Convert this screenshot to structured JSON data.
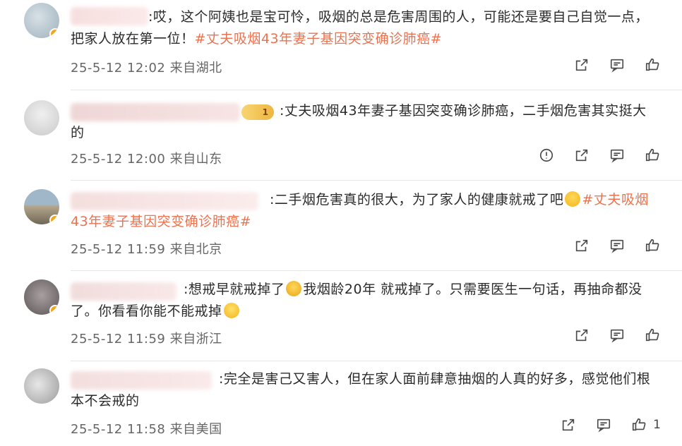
{
  "colors": {
    "hashtag": "#eb7350",
    "text": "#2b2b2b",
    "meta": "#666666",
    "divider": "#e6e6e6"
  },
  "comments": [
    {
      "text": ":哎，这个阿姨也是宝可怜，吸烟的总是危害周围的人，可能还是要自己自觉一点，把家人放在第一位！",
      "hashtag": "#丈夫吸烟43年妻子基因突变确诊肺癌#",
      "time": "25-5-12 12:02",
      "location": "来自湖北"
    },
    {
      "badge": "1",
      "text": ":丈夫吸烟43年妻子基因突变确诊肺癌，二手烟危害其实挺大的",
      "time": "25-5-12 12:00",
      "location": "来自山东"
    },
    {
      "text": ":二手烟危害真的很大，为了家人的健康就戒了吧",
      "hashtag": "#丈夫吸烟43年妻子基因突变确诊肺癌#",
      "time": "25-5-12 11:59",
      "location": "来自北京"
    },
    {
      "text_a": ":想戒早就戒掉了",
      "text_b": "我烟龄20年 就戒掉了。只需要医生一句话，再抽命都没了。你看看你能不能戒掉",
      "time": "25-5-12 11:59",
      "location": "来自浙江"
    },
    {
      "text": ":完全是害己又害人，但在家人面前肆意抽烟的人真的好多，感觉他们根本不会戒的",
      "time": "25-5-12 11:58",
      "location": "来自美国",
      "like_count": "1"
    }
  ]
}
